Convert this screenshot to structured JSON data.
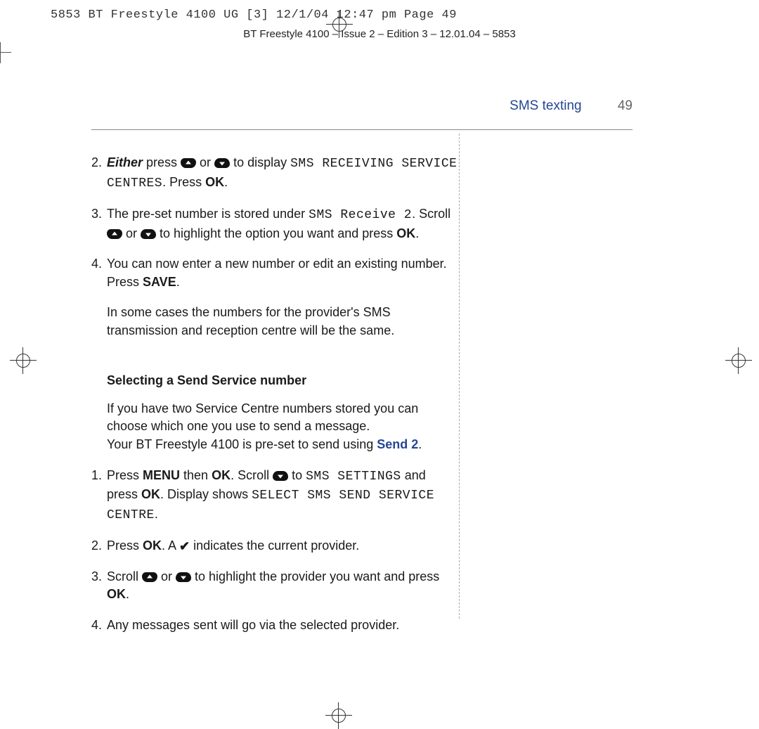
{
  "print_header": "5853 BT Freestyle 4100 UG [3]  12/1/04  12:47 pm  Page 49",
  "doc_header": "BT Freestyle 4100 – Issue 2 – Edition 3 – 12.01.04 – 5853",
  "running_head": {
    "section": "SMS texting",
    "pageno": "49"
  },
  "steps_a": [
    {
      "num": "2.",
      "parts": [
        {
          "t": "Either",
          "cls": "ital"
        },
        {
          "t": " press "
        },
        {
          "icon": "up"
        },
        {
          "t": " or "
        },
        {
          "icon": "down"
        },
        {
          "t": " to display "
        },
        {
          "t": "SMS RECEIVING SERVICE CENTRES",
          "cls": "lcd"
        },
        {
          "t": ". Press "
        },
        {
          "t": "OK",
          "cls": "bold"
        },
        {
          "t": "."
        }
      ]
    },
    {
      "num": "3.",
      "parts": [
        {
          "t": "The pre-set number is stored under "
        },
        {
          "t": "SMS Receive 2",
          "cls": "lcd"
        },
        {
          "t": ". Scroll "
        },
        {
          "icon": "up"
        },
        {
          "t": " or "
        },
        {
          "icon": "down"
        },
        {
          "t": " to highlight the option you want and press "
        },
        {
          "t": "OK",
          "cls": "bold"
        },
        {
          "t": "."
        }
      ]
    },
    {
      "num": "4.",
      "parts": [
        {
          "t": "You can now enter a new number or edit an existing number. Press "
        },
        {
          "t": "SAVE",
          "cls": "bold"
        },
        {
          "t": "."
        }
      ]
    }
  ],
  "note_a": "In some cases the numbers for the provider's SMS transmission and reception centre will be the same.",
  "heading_b": "Selecting a Send Service number",
  "intro_b_parts": [
    {
      "t": "If you have two Service Centre numbers stored you can choose which one you use to send a message."
    },
    {
      "br": true
    },
    {
      "t": "Your BT Freestyle 4100 is pre-set to send using "
    },
    {
      "t": "Send 2",
      "cls": "blue-bold"
    },
    {
      "t": "."
    }
  ],
  "steps_b": [
    {
      "num": "1.",
      "parts": [
        {
          "t": "Press "
        },
        {
          "t": "MENU",
          "cls": "bold"
        },
        {
          "t": " then "
        },
        {
          "t": "OK",
          "cls": "bold"
        },
        {
          "t": ". Scroll "
        },
        {
          "icon": "down"
        },
        {
          "t": " to "
        },
        {
          "t": "SMS SETTINGS",
          "cls": "lcd"
        },
        {
          "t": " and press "
        },
        {
          "t": "OK",
          "cls": "bold"
        },
        {
          "t": ". Display shows "
        },
        {
          "t": "SELECT SMS SEND SERVICE CENTRE",
          "cls": "lcd"
        },
        {
          "t": "."
        }
      ]
    },
    {
      "num": "2.",
      "parts": [
        {
          "t": "Press "
        },
        {
          "t": "OK",
          "cls": "bold"
        },
        {
          "t": ". A "
        },
        {
          "tick": true
        },
        {
          "t": " indicates the current provider."
        }
      ]
    },
    {
      "num": "3.",
      "parts": [
        {
          "t": "Scroll "
        },
        {
          "icon": "up"
        },
        {
          "t": " or "
        },
        {
          "icon": "down"
        },
        {
          "t": " to highlight the provider you want and press "
        },
        {
          "t": "OK",
          "cls": "bold"
        },
        {
          "t": "."
        }
      ]
    },
    {
      "num": "4.",
      "parts": [
        {
          "t": "Any messages sent will go via the selected provider."
        }
      ]
    }
  ]
}
